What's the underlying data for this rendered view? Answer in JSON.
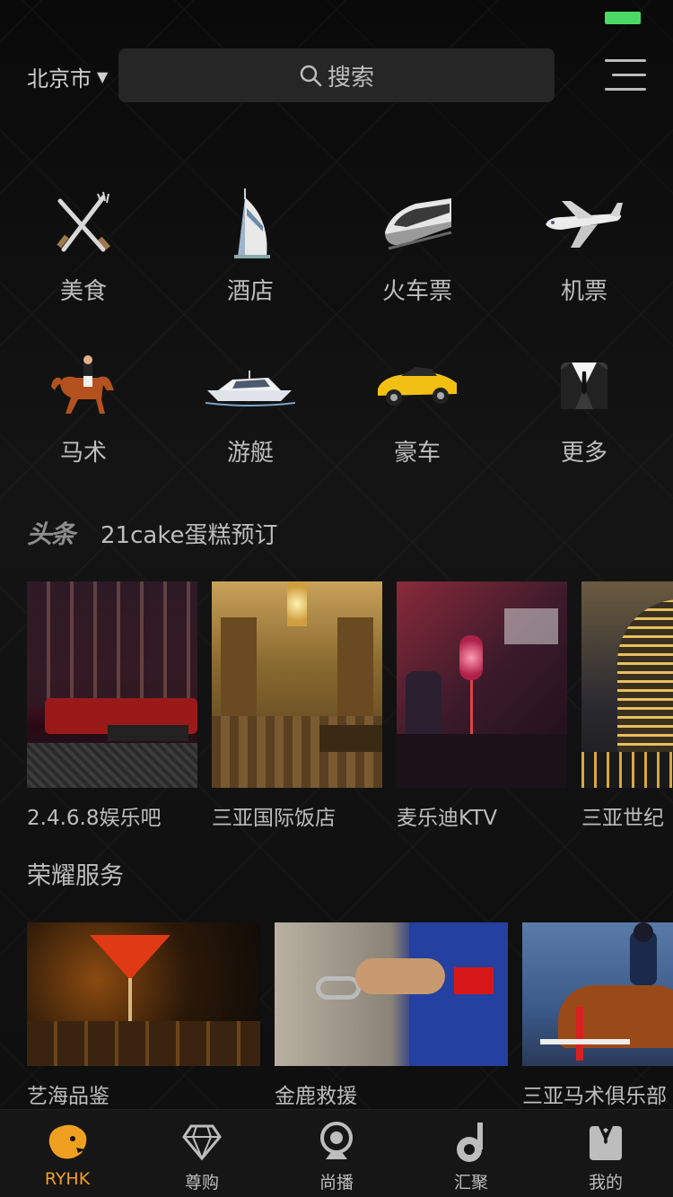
{
  "header": {
    "city": "北京市",
    "search_label": "搜索"
  },
  "categories": [
    {
      "label": "美食",
      "icon": "fork-knife-icon"
    },
    {
      "label": "酒店",
      "icon": "hotel-tower-icon"
    },
    {
      "label": "火车票",
      "icon": "train-icon"
    },
    {
      "label": "机票",
      "icon": "airplane-icon"
    },
    {
      "label": "马术",
      "icon": "horse-rider-icon"
    },
    {
      "label": "游艇",
      "icon": "yacht-icon"
    },
    {
      "label": "豪车",
      "icon": "sports-car-icon"
    },
    {
      "label": "更多",
      "icon": "tuxedo-icon"
    }
  ],
  "headline": {
    "logo": "头条",
    "text": "21cake蛋糕预订"
  },
  "venues": [
    {
      "label": "2.4.6.8娱乐吧"
    },
    {
      "label": "三亚国际饭店"
    },
    {
      "label": "麦乐迪KTV"
    },
    {
      "label": "三亚世纪"
    }
  ],
  "section_title": "荣耀服务",
  "services": [
    {
      "label": "艺海品鉴"
    },
    {
      "label": "金鹿救援"
    },
    {
      "label": "三亚马术俱乐部"
    }
  ],
  "tabs": [
    {
      "label": "RYHK",
      "icon": "lion-icon",
      "active": true
    },
    {
      "label": "尊购",
      "icon": "diamond-icon",
      "active": false
    },
    {
      "label": "尚播",
      "icon": "webcam-icon",
      "active": false
    },
    {
      "label": "汇聚",
      "icon": "music-note-icon",
      "active": false
    },
    {
      "label": "我的",
      "icon": "suit-icon",
      "active": false
    }
  ],
  "colors": {
    "active_tab": "#f0a020",
    "battery": "#4cd964",
    "background": "#0b0b0b"
  }
}
